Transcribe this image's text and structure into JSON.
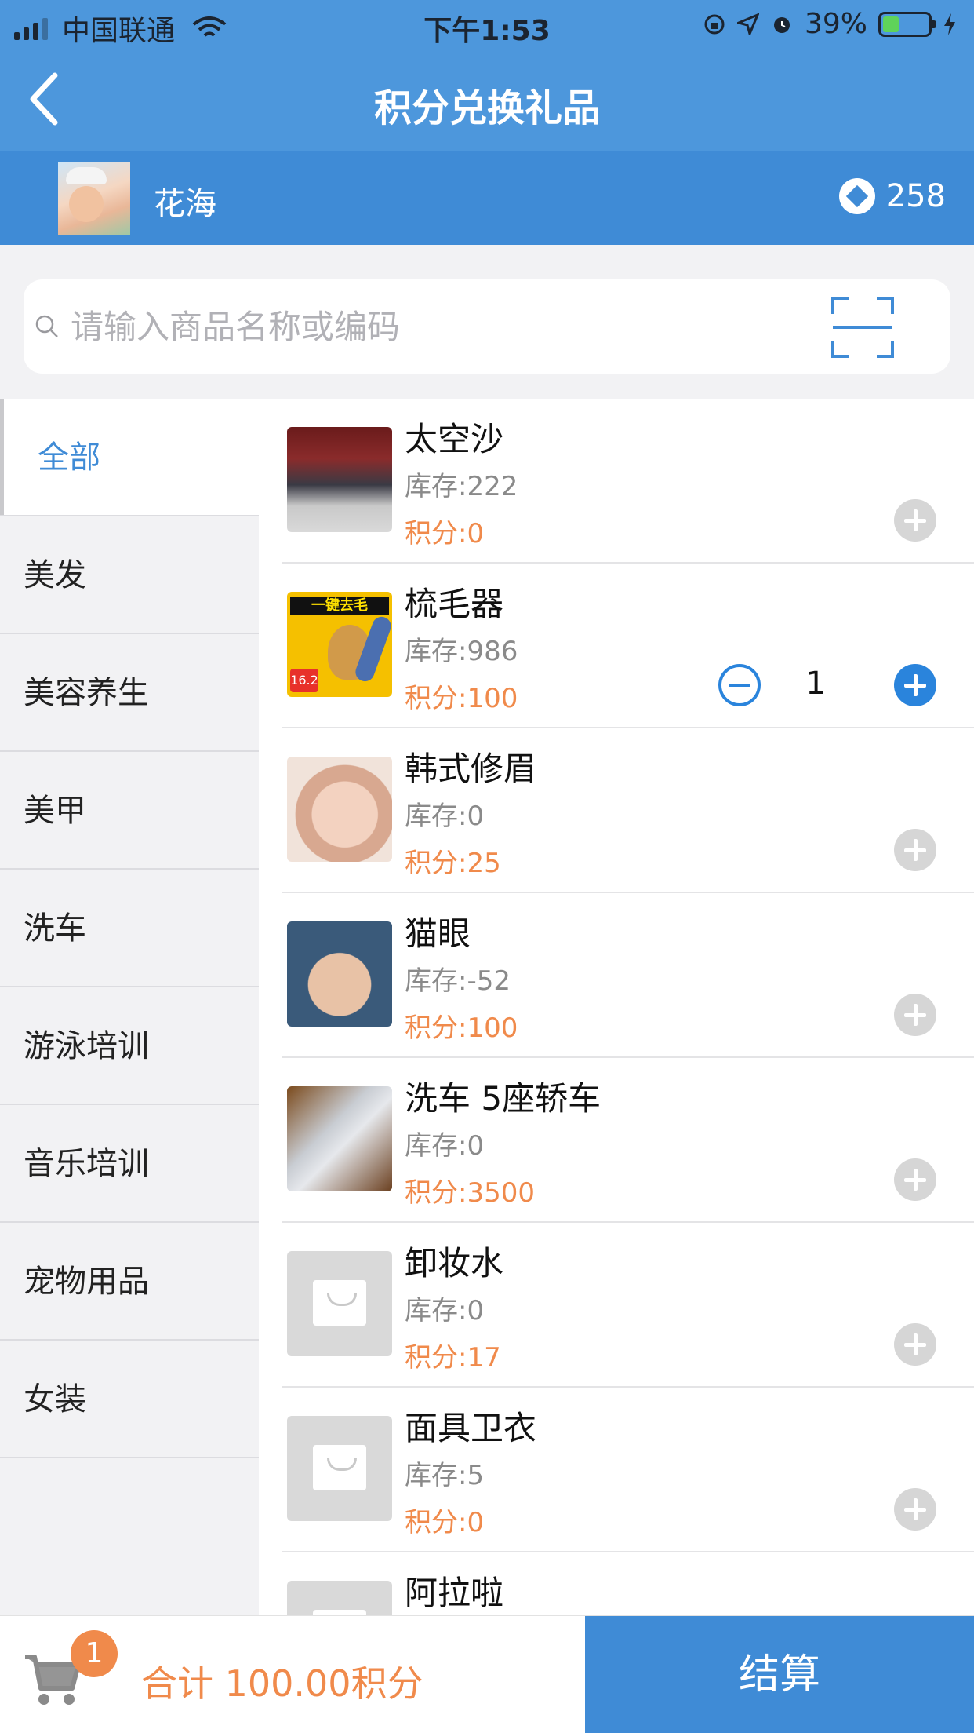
{
  "status_bar": {
    "carrier": "中国联通",
    "time": "下午1:53",
    "battery": "39%"
  },
  "nav": {
    "title": "积分兑换礼品"
  },
  "member": {
    "name": "花海",
    "points": "258"
  },
  "search": {
    "placeholder": "请输入商品名称或编码"
  },
  "categories": [
    {
      "label": "全部",
      "active": true
    },
    {
      "label": "美发"
    },
    {
      "label": "美容养生"
    },
    {
      "label": "美甲"
    },
    {
      "label": "洗车"
    },
    {
      "label": "游泳培训"
    },
    {
      "label": "音乐培训"
    },
    {
      "label": "宠物用品"
    },
    {
      "label": "女装"
    }
  ],
  "products": [
    {
      "name": "太空沙",
      "stock": "库存:222",
      "score": "积分:0",
      "thumb": "photo-gym"
    },
    {
      "name": "梳毛器",
      "stock": "库存:986",
      "score": "积分:100",
      "thumb": "photo-pet-brush",
      "qty": "1",
      "thumb_text": "一键去毛",
      "thumb_price": "16.2"
    },
    {
      "name": "韩式修眉",
      "stock": "库存:0",
      "score": "积分:25",
      "thumb": "photo-eyebrow"
    },
    {
      "name": "猫眼",
      "stock": "库存:-52",
      "score": "积分:100",
      "thumb": "photo-nails"
    },
    {
      "name": "洗车 5座轿车",
      "stock": "库存:0",
      "score": "积分:3500",
      "thumb": "photo-car"
    },
    {
      "name": "卸妆水",
      "stock": "库存:0",
      "score": "积分:17",
      "thumb": "placeholder"
    },
    {
      "name": "面具卫衣",
      "stock": "库存:5",
      "score": "积分:0",
      "thumb": "placeholder"
    },
    {
      "name": "阿拉啦",
      "thumb": "placeholder"
    }
  ],
  "cart": {
    "badge": "1",
    "total": "合计 100.00积分",
    "checkout": "结算"
  },
  "colors": {
    "primary": "#3f8bd6",
    "accent_orange": "#f08a4b",
    "add_active": "#2a84dc"
  }
}
